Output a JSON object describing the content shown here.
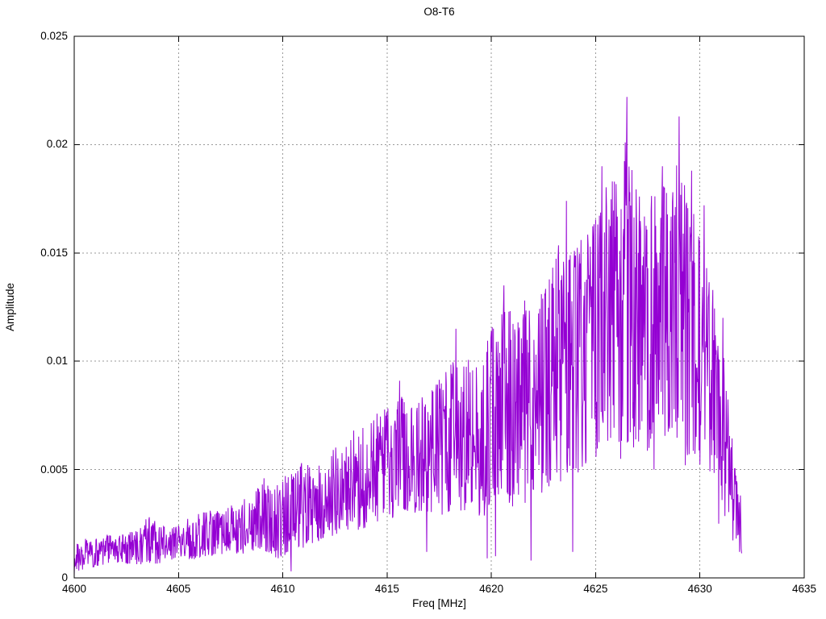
{
  "page": {
    "background": "#ffffff"
  },
  "chart_data": {
    "type": "line",
    "title": "O8-T6",
    "xlabel": "Freq [MHz]",
    "ylabel": "Amplitude",
    "xlim": [
      4600,
      4635
    ],
    "ylim": [
      0,
      0.025
    ],
    "xticks": [
      4600,
      4605,
      4610,
      4615,
      4620,
      4625,
      4630,
      4635
    ],
    "yticks": [
      0,
      0.005,
      0.01,
      0.015,
      0.02,
      0.025
    ],
    "grid": true,
    "legend": "none",
    "line_color": "#9400d3",
    "grid_color": "#9a9a9a",
    "border_color": "#000000",
    "text_color": "#000000",
    "x_start": 4600,
    "x_end": 4632,
    "sample_step": 0.02,
    "envelope": [
      [
        4600.0,
        0.0002,
        0.0015
      ],
      [
        4600.5,
        0.0004,
        0.0018
      ],
      [
        4601.0,
        0.0005,
        0.0019
      ],
      [
        4601.5,
        0.0006,
        0.002
      ],
      [
        4602.0,
        0.0007,
        0.002
      ],
      [
        4602.5,
        0.0006,
        0.0021
      ],
      [
        4603.0,
        0.0005,
        0.0022
      ],
      [
        4603.5,
        0.0007,
        0.0028
      ],
      [
        4604.0,
        0.0006,
        0.0026
      ],
      [
        4604.5,
        0.0008,
        0.0022
      ],
      [
        4605.0,
        0.0009,
        0.0025
      ],
      [
        4605.5,
        0.0008,
        0.0028
      ],
      [
        4606.0,
        0.0009,
        0.003
      ],
      [
        4607.0,
        0.001,
        0.0032
      ],
      [
        4608.0,
        0.001,
        0.0035
      ],
      [
        4608.5,
        0.0012,
        0.004
      ],
      [
        4609.0,
        0.0013,
        0.0045
      ],
      [
        4609.5,
        0.001,
        0.0042
      ],
      [
        4610.0,
        0.0008,
        0.0048
      ],
      [
        4610.5,
        0.001,
        0.005
      ],
      [
        4611.0,
        0.0014,
        0.0052
      ],
      [
        4612.0,
        0.0018,
        0.0055
      ],
      [
        4613.0,
        0.002,
        0.0065
      ],
      [
        4614.0,
        0.0022,
        0.0072
      ],
      [
        4615.0,
        0.0025,
        0.008
      ],
      [
        4615.5,
        0.0028,
        0.0088
      ],
      [
        4616.0,
        0.003,
        0.008
      ],
      [
        4617.0,
        0.003,
        0.0085
      ],
      [
        4618.0,
        0.0028,
        0.0098
      ],
      [
        4618.5,
        0.003,
        0.0105
      ],
      [
        4619.0,
        0.0032,
        0.01
      ],
      [
        4619.5,
        0.0025,
        0.0098
      ],
      [
        4620.0,
        0.0035,
        0.0118
      ],
      [
        4620.5,
        0.004,
        0.0128
      ],
      [
        4621.0,
        0.0032,
        0.0122
      ],
      [
        4622.0,
        0.0035,
        0.0125
      ],
      [
        4622.5,
        0.004,
        0.013
      ],
      [
        4623.0,
        0.0042,
        0.0148
      ],
      [
        4623.5,
        0.0045,
        0.0165
      ],
      [
        4624.0,
        0.0045,
        0.0152
      ],
      [
        4624.5,
        0.005,
        0.0158
      ],
      [
        4625.0,
        0.005,
        0.0172
      ],
      [
        4625.5,
        0.0055,
        0.0182
      ],
      [
        4626.0,
        0.006,
        0.019
      ],
      [
        4626.5,
        0.006,
        0.0205
      ],
      [
        4627.0,
        0.0055,
        0.018
      ],
      [
        4627.5,
        0.0058,
        0.0172
      ],
      [
        4628.0,
        0.006,
        0.0185
      ],
      [
        4628.5,
        0.0062,
        0.018
      ],
      [
        4629.0,
        0.0058,
        0.0195
      ],
      [
        4629.5,
        0.0055,
        0.0178
      ],
      [
        4630.0,
        0.005,
        0.0165
      ],
      [
        4630.5,
        0.0045,
        0.014
      ],
      [
        4631.0,
        0.003,
        0.0115
      ],
      [
        4631.4,
        0.002,
        0.008
      ],
      [
        4631.7,
        0.0015,
        0.0055
      ],
      [
        4632.0,
        0.001,
        0.0038
      ]
    ],
    "peaks": [
      [
        4603.6,
        0.0028
      ],
      [
        4609.1,
        0.0046
      ],
      [
        4610.9,
        0.0053
      ],
      [
        4613.4,
        0.0068
      ],
      [
        4615.6,
        0.0091
      ],
      [
        4617.2,
        0.0086
      ],
      [
        4618.3,
        0.0115
      ],
      [
        4620.6,
        0.0135
      ],
      [
        4621.6,
        0.0128
      ],
      [
        4622.4,
        0.0131
      ],
      [
        4623.6,
        0.0174
      ],
      [
        4624.3,
        0.0156
      ],
      [
        4625.3,
        0.019
      ],
      [
        4625.8,
        0.0183
      ],
      [
        4626.5,
        0.0222
      ],
      [
        4627.1,
        0.0176
      ],
      [
        4628.2,
        0.019
      ],
      [
        4628.7,
        0.0178
      ],
      [
        4629.0,
        0.0213
      ],
      [
        4629.6,
        0.0188
      ],
      [
        4630.2,
        0.0172
      ],
      [
        4631.1,
        0.012
      ]
    ],
    "dips": [
      [
        4600.0,
        0.0001
      ],
      [
        4610.4,
        0.0003
      ],
      [
        4616.9,
        0.0012
      ],
      [
        4619.8,
        0.0009
      ],
      [
        4620.2,
        0.001
      ],
      [
        4621.9,
        0.0008
      ],
      [
        4623.9,
        0.0012
      ],
      [
        4626.2,
        0.0055
      ],
      [
        4627.8,
        0.005
      ],
      [
        4629.3,
        0.0052
      ],
      [
        4630.9,
        0.0025
      ],
      [
        4631.9,
        0.0012
      ]
    ]
  }
}
